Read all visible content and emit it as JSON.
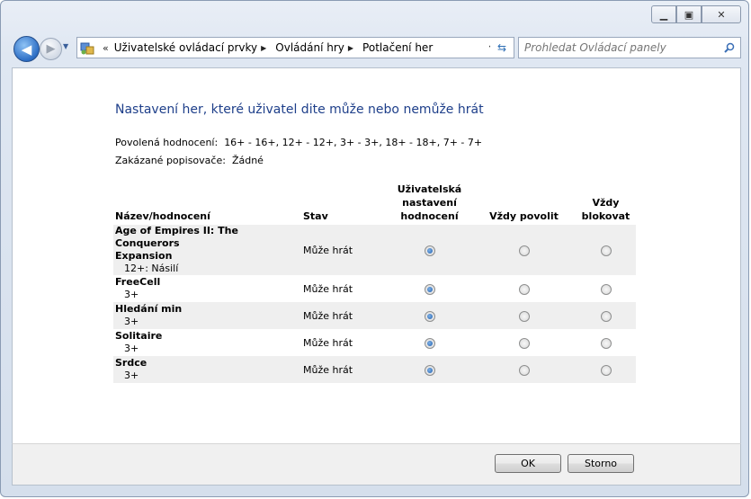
{
  "window": {
    "minimize_icon": "minimize-icon",
    "maximize_icon": "maximize-icon",
    "close_icon": "close-icon"
  },
  "nav": {
    "breadcrumb_prefix": "«",
    "breadcrumbs": [
      {
        "label": "Uživatelské ovládací prvky"
      },
      {
        "label": "Ovládání hry"
      },
      {
        "label": "Potlačení her"
      }
    ],
    "search_placeholder": "Prohledat Ovládací panely"
  },
  "main": {
    "heading": "Nastavení her, které uživatel dite může nebo nemůže hrát",
    "allowed_label": "Povolená hodnocení:",
    "allowed_value": "16+ - 16+, 12+ - 12+, 3+ - 3+, 18+ - 18+, 7+ - 7+",
    "blocked_label": "Zakázané popisovače:",
    "blocked_value": "Žádné",
    "columns": {
      "name": "Název/hodnocení",
      "status": "Stav",
      "user_rating_1": "Uživatelská",
      "user_rating_2": "nastavení",
      "user_rating_3": "hodnocení",
      "always_allow": "Vždy povolit",
      "always_block_1": "Vždy",
      "always_block_2": "blokovat"
    },
    "games": [
      {
        "name_line1": "Age of Empires II: The Conquerors",
        "name_line2": "Expansion",
        "rating": "12+: Násilí",
        "status": "Může hrát",
        "selected": "user"
      },
      {
        "name_line1": "FreeCell",
        "rating": "3+",
        "status": "Může hrát",
        "selected": "user"
      },
      {
        "name_line1": "Hledání min",
        "rating": "3+",
        "status": "Může hrát",
        "selected": "user"
      },
      {
        "name_line1": "Solitaire",
        "rating": "3+",
        "status": "Může hrát",
        "selected": "user"
      },
      {
        "name_line1": "Srdce",
        "rating": "3+",
        "status": "Může hrát",
        "selected": "user"
      }
    ]
  },
  "footer": {
    "ok_label": "OK",
    "cancel_label": "Storno"
  }
}
